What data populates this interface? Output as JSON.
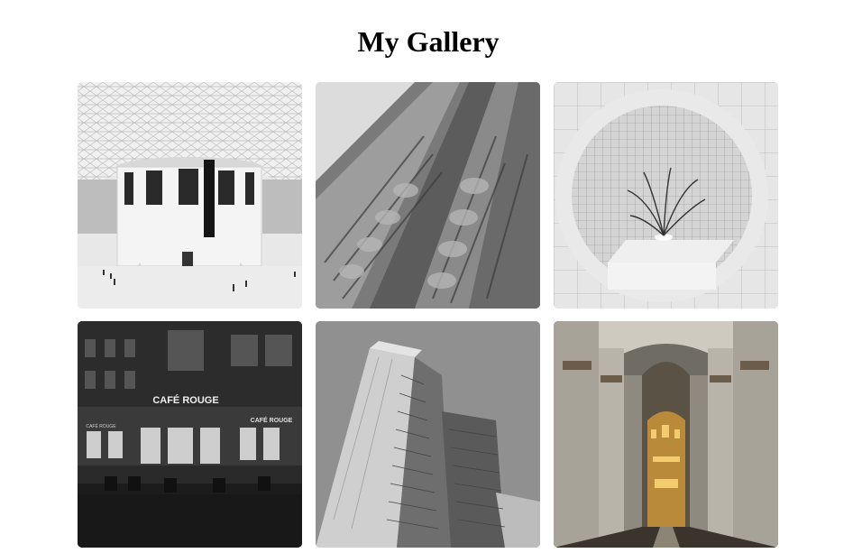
{
  "page": {
    "title": "My Gallery"
  },
  "gallery": {
    "photos": [
      {
        "subject": "glass-dome-atrium"
      },
      {
        "subject": "ornate-building-facade"
      },
      {
        "subject": "round-window-plant"
      },
      {
        "subject": "cafe-storefront-night",
        "sign_text": "CAFÉ ROUGE",
        "sign_text_small": "CAFÉ ROUGE",
        "sign_text_left": "CAFÉ ROUGE"
      },
      {
        "subject": "glass-tower"
      },
      {
        "subject": "cathedral-interior"
      }
    ]
  }
}
